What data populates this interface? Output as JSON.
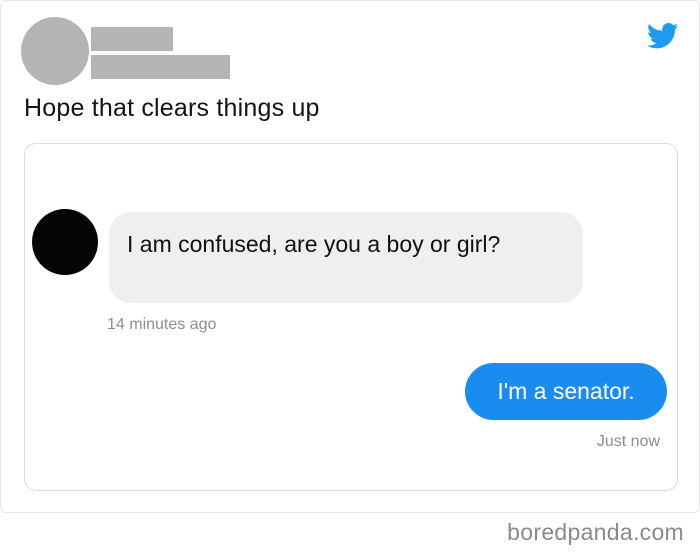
{
  "tweet": {
    "text": "Hope that clears things up",
    "platform_icon": "twitter-bird-icon",
    "accent_color": "#1d9bf0"
  },
  "conversation": {
    "incoming": {
      "text": "I am confused, are you a boy or girl?",
      "timestamp": "14 minutes ago"
    },
    "outgoing": {
      "text": "I'm a senator.",
      "timestamp": "Just now",
      "bubble_color": "#1a8cf0"
    }
  },
  "watermark": "boredpanda.com"
}
